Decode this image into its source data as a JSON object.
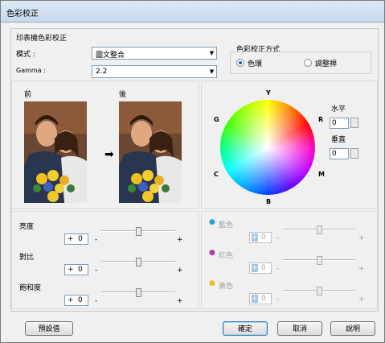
{
  "window": {
    "title": "色彩校正"
  },
  "printer_group": {
    "title": "印表機色彩校正"
  },
  "mode": {
    "label": "模式 :",
    "value": "圖文整合"
  },
  "gamma": {
    "label": "Gamma :",
    "value": "2.2"
  },
  "method": {
    "title": "色彩校正方式",
    "options": [
      "色環",
      "調整桿"
    ],
    "selected": "色環"
  },
  "preview": {
    "before": "前",
    "after": "後",
    "arrow_icon": "right-arrow-icon"
  },
  "wheel": {
    "top": "Y",
    "right_top": "R",
    "right_bottom": "M",
    "bottom": "B",
    "left_bottom": "C",
    "left_top": "G",
    "horizontal_label": "水平",
    "horizontal_value": "0",
    "vertical_label": "垂直",
    "vertical_value": "0"
  },
  "adjust": [
    {
      "label": "亮度",
      "sign": "+",
      "value": "0",
      "minus": "-",
      "plus": "+",
      "level": 0.5
    },
    {
      "label": "對比",
      "sign": "+",
      "value": "0",
      "minus": "-",
      "plus": "+",
      "level": 0.5
    },
    {
      "label": "飽和度",
      "sign": "+",
      "value": "0",
      "minus": "-",
      "plus": "+",
      "level": 0.5
    }
  ],
  "color_adjust": [
    {
      "label": "藍色",
      "sign": "+",
      "value": "0",
      "minus": "-",
      "plus": "+",
      "icon": "cyan-drop-icon",
      "color": "#2a9fd6",
      "level": 0.5
    },
    {
      "label": "紅色",
      "sign": "+",
      "value": "0",
      "minus": "-",
      "plus": "+",
      "icon": "magenta-drop-icon",
      "color": "#b03aa8",
      "level": 0.5
    },
    {
      "label": "黃色",
      "sign": "+",
      "value": "0",
      "minus": "-",
      "plus": "+",
      "icon": "yellow-drop-icon",
      "color": "#e8c020",
      "level": 0.5
    }
  ],
  "buttons": {
    "default": "預設值",
    "ok": "確定",
    "cancel": "取消",
    "help": "說明"
  }
}
